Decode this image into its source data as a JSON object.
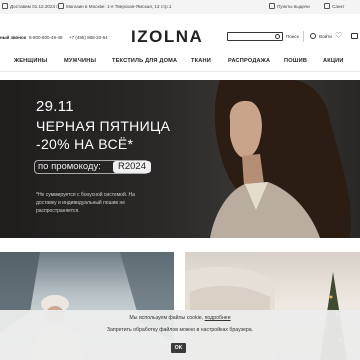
{
  "topbar": {
    "delivery_text": "Доставим 01.12.2024 г.",
    "store_text": "Магазин в Москве: 1-я Тверская-Ямская, 13 стр.1",
    "pickup_text": "Пункты выдачи",
    "city_text": "Санкт"
  },
  "header": {
    "phone_label": "ный звонок",
    "phone1": "8-800-600-49-46",
    "phone2": "+7 (495) 968-20-64",
    "logo": "IZOLNA",
    "search_placeholder": "",
    "search_button": "Поиск",
    "login_label": "Войти"
  },
  "nav": {
    "items": [
      "ЖЕНЩИНЫ",
      "МУЖЧИНЫ",
      "ТЕКСТИЛЬ ДЛЯ ДОМА",
      "ТКАНИ",
      "РАСПРОДАЖА",
      "ПОШИВ",
      "АКЦИИ"
    ]
  },
  "hero": {
    "date": "29.11",
    "line1": "ЧЕРНАЯ ПЯТНИЦА",
    "line2": "-20% НА ВСЁ*",
    "promo_label": "по промокоду:",
    "promo_code": "R2024",
    "note": "*Не суммируется с бонусной системой. На доставку и индивидуальный пошив не распространяется."
  },
  "cookie": {
    "line1_text": "Мы используем файлы cookie,",
    "line1_link": "подробнее",
    "line2_text": "Запретить обработку файлов можно в настройках браузера.",
    "ok_label": "OK"
  }
}
